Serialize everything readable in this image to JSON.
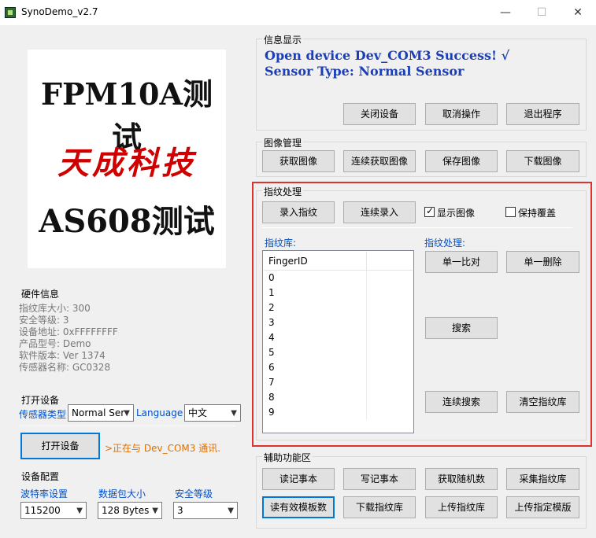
{
  "window": {
    "title": "SynoDemo_v2.7",
    "controls": {
      "minimize": "—",
      "maximize": "☐",
      "close": "✕"
    }
  },
  "logo": {
    "line1": "FPM10A测试",
    "line2": "天成科技",
    "line3": "AS608测试"
  },
  "hardware": {
    "title": "硬件信息",
    "lines": [
      "指纹库大小: 300",
      "安全等级: 3",
      "设备地址: 0xFFFFFFFF",
      "产品型号:  Demo",
      "软件版本: Ver 1374",
      "传感器名称: GC0328"
    ]
  },
  "open_device": {
    "title": "打开设备",
    "sensor_type_label": "传感器类型",
    "sensor_type_value": "Normal Ser",
    "language_label": "Language",
    "language_value": "中文",
    "open_button": "打开设备",
    "status": ">正在与 Dev_COM3 通讯."
  },
  "device_config": {
    "title": "设备配置",
    "baud_label": "波特率设置",
    "baud_value": "115200",
    "packet_label": "数据包大小",
    "packet_value": "128 Bytes",
    "security_label": "安全等级",
    "security_value": "3"
  },
  "info": {
    "title": "信息显示",
    "line1": "Open device Dev_COM3 Success! √",
    "line2": "Sensor Type: Normal Sensor",
    "buttons": {
      "close_device": "关闭设备",
      "cancel": "取消操作",
      "exit": "退出程序"
    }
  },
  "image_mgmt": {
    "title": "图像管理",
    "buttons": {
      "get": "获取图像",
      "get_continuous": "连续获取图像",
      "save": "保存图像",
      "download": "下载图像"
    }
  },
  "fingerprint": {
    "title": "指纹处理",
    "enroll": "录入指纹",
    "enroll_continuous": "连续录入",
    "show_image_label": "显示图像",
    "show_image_checked": true,
    "keep_overwrite_label": "保持覆盖",
    "keep_overwrite_checked": false,
    "library_label": "指纹库:",
    "process_label": "指纹处理:",
    "list_header": "FingerID",
    "list_rows": [
      "0",
      "1",
      "2",
      "3",
      "4",
      "5",
      "6",
      "7",
      "8",
      "9"
    ],
    "buttons": {
      "match_single": "单一比对",
      "delete_single": "单一删除",
      "search": "搜索",
      "search_continuous": "连续搜索",
      "clear_library": "清空指纹库"
    }
  },
  "aux": {
    "title": "辅助功能区",
    "buttons": {
      "read_notes": "读记事本",
      "write_notes": "写记事本",
      "get_random": "获取随机数",
      "collect_library": "采集指纹库",
      "read_valid": "读有效模板数",
      "download_library": "下载指纹库",
      "upload_library": "上传指纹库",
      "upload_template": "上传指定模版"
    }
  }
}
